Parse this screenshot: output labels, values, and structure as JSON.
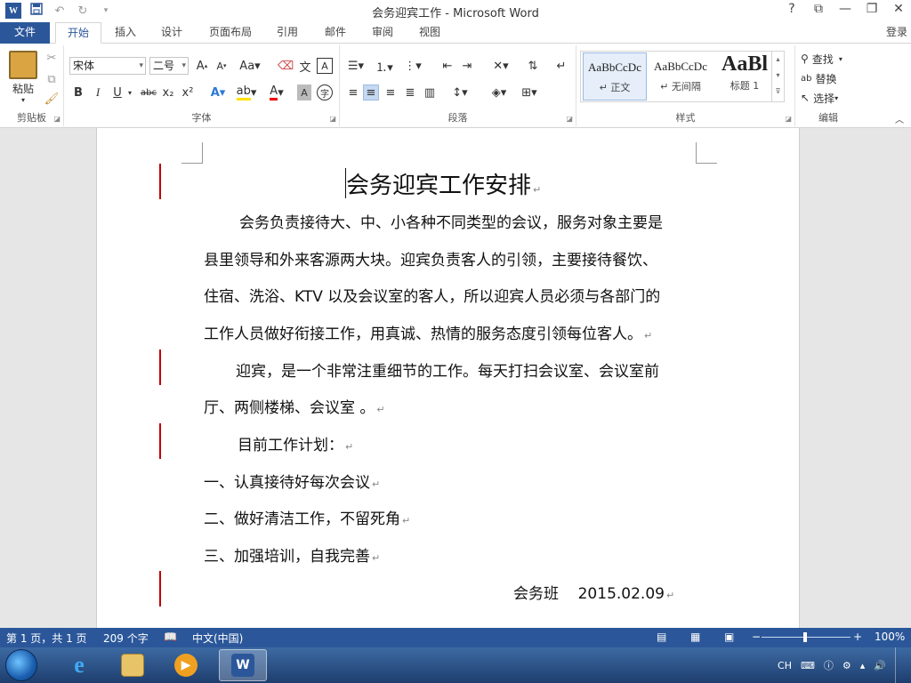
{
  "window": {
    "title": "会务迎宾工作 - Microsoft Word",
    "qat": {
      "word_icon": "W",
      "undo_icon": "↶",
      "redo_icon": "↻"
    },
    "controls": {
      "help": "?",
      "ribbon_display": "⧉",
      "minimize": "—",
      "restore": "❐",
      "close": "✕"
    }
  },
  "tabs": [
    {
      "label": "文件"
    },
    {
      "label": "开始"
    },
    {
      "label": "插入"
    },
    {
      "label": "设计"
    },
    {
      "label": "页面布局"
    },
    {
      "label": "引用"
    },
    {
      "label": "邮件"
    },
    {
      "label": "审阅"
    },
    {
      "label": "视图"
    }
  ],
  "signin": "登录",
  "ribbon": {
    "clipboard": {
      "paste_label": "粘贴",
      "group_label": "剪贴板"
    },
    "font": {
      "font_name": "宋体",
      "font_size": "二号",
      "group_label": "字体",
      "bold": "B",
      "italic": "I",
      "underline": "U",
      "strike": "abc",
      "subscript": "x₂",
      "superscript": "x²"
    },
    "paragraph": {
      "group_label": "段落"
    },
    "styles": {
      "group_label": "样式",
      "items": [
        {
          "sample": "AaBbCcDc",
          "name": "↵ 正文"
        },
        {
          "sample": "AaBbCcDc",
          "name": "↵ 无间隔"
        },
        {
          "sample": "AaBl",
          "name": "标题 1"
        }
      ]
    },
    "editing": {
      "find": "查找",
      "replace": "替换",
      "select": "选择",
      "group_label": "编辑"
    }
  },
  "document": {
    "title": "会务迎宾工作安排",
    "lines": [
      "会务负责接待大、中、小各种不同类型的会议，服务对象主要是",
      "县里领导和外来客源两大块。迎宾负责客人的引领，主要接待餐饮、",
      "住宿、洗浴、KTV 以及会议室的客人，所以迎宾人员必须与各部门的",
      "工作人员做好衔接工作，用真诚、热情的服务态度引领每位客人。",
      "迎宾，是一个非常注重细节的工作。每天打扫会议室、会议室前",
      "厅、两侧楼梯、会议室 。",
      "目前工作计划：",
      "一、认真接待好每次会议",
      "二、做好清洁工作，不留死角",
      "三、加强培训，自我完善",
      "会务班    2015.02.09"
    ],
    "paragraph_mark": "↵"
  },
  "statusbar": {
    "page": "第 1 页，共 1 页",
    "words": "209 个字",
    "language": "中文(中国)",
    "zoom_level": "100%"
  },
  "taskbar": {
    "ime": "CH",
    "active_app": "W"
  },
  "colors": {
    "accent": "#2b579a",
    "revision_bar": "#c00000"
  }
}
